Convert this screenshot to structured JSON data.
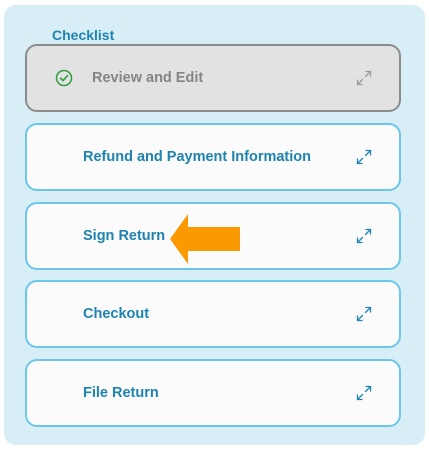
{
  "checklist": {
    "title": "Checklist",
    "items": [
      {
        "label": "Review and Edit",
        "status": "done"
      },
      {
        "label": "Refund and Payment Information",
        "status": "pending"
      },
      {
        "label": "Sign Return",
        "status": "pending"
      },
      {
        "label": "Checkout",
        "status": "pending"
      },
      {
        "label": "File Return",
        "status": "pending"
      }
    ]
  },
  "icons": {
    "completed": "check-circle-icon",
    "expand": "expand-icon",
    "pointer": "left-arrow-icon"
  },
  "colors": {
    "accent": "#1e83b0",
    "card_border": "#6cc6ea",
    "panel_bg": "#d8eef7",
    "done_bg": "#e2e2e2",
    "done_text": "#858585",
    "check": "#2e9e3e",
    "arrow": "#fb9a00"
  }
}
